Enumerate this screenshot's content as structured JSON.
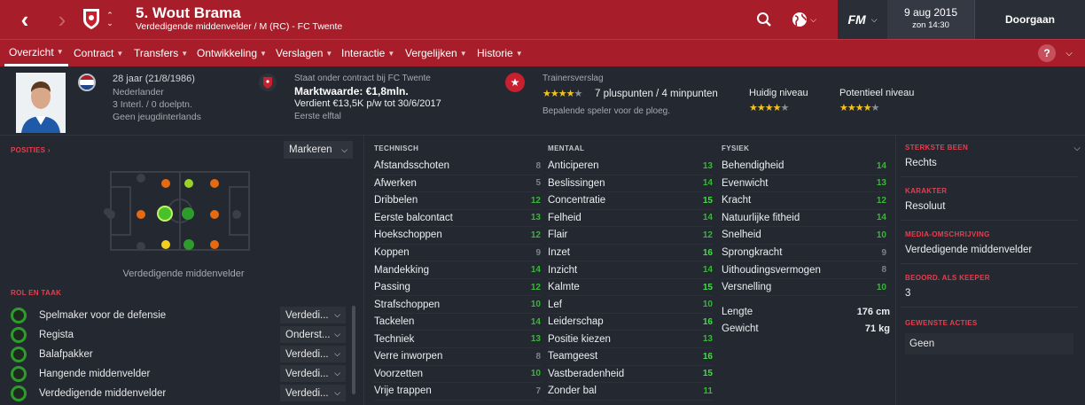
{
  "header": {
    "title": "5. Wout Brama",
    "subtitle": "Verdedigende middenvelder / M (RC) - FC Twente",
    "fm_logo": "FM",
    "date": "9 aug 2015",
    "time": "zon 14:30",
    "continue_label": "Doorgaan",
    "accent_color": "#a71d2a"
  },
  "menu": [
    {
      "label": "Overzicht"
    },
    {
      "label": "Contract"
    },
    {
      "label": "Transfers"
    },
    {
      "label": "Ontwikkeling"
    },
    {
      "label": "Verslagen"
    },
    {
      "label": "Interactie"
    },
    {
      "label": "Vergelijken"
    },
    {
      "label": "Historie"
    }
  ],
  "info": {
    "age": "28 jaar (21/8/1986)",
    "nationality": "Nederlander",
    "caps": "3 Interl. / 0 doelptn.",
    "youth": "Geen jeugdinterlands",
    "contract_label": "Staat onder contract bij FC Twente",
    "value": "Marktwaarde: €1,8mln.",
    "wage": "Verdient €13,5K p/w tot 30/6/2017",
    "squad": "Eerste elftal",
    "scout_label": "Trainersverslag",
    "points": "7 pluspunten / 4 minpunten",
    "scout_note": "Bepalende speler voor de ploeg.",
    "current_label": "Huidig niveau",
    "potential_label": "Potentieel niveau",
    "scout_stars": 4,
    "current_stars": 4,
    "potential_stars": 4
  },
  "positions": {
    "label": "POSITIES",
    "markeren": "Markeren",
    "caption": "Verdedigende middenvelder"
  },
  "roles": {
    "label": "ROL EN TAAK",
    "items": [
      {
        "name": "Spelmaker voor de defensie",
        "duty": "Verdedi..."
      },
      {
        "name": "Regista",
        "duty": "Onderst..."
      },
      {
        "name": "Balafpakker",
        "duty": "Verdedi..."
      },
      {
        "name": "Hangende middenvelder",
        "duty": "Verdedi..."
      },
      {
        "name": "Verdedigende middenvelder",
        "duty": "Verdedi..."
      }
    ]
  },
  "technical": {
    "label": "TECHNISCH",
    "items": [
      {
        "name": "Afstandsschoten",
        "value": "8"
      },
      {
        "name": "Afwerken",
        "value": "5"
      },
      {
        "name": "Dribbelen",
        "value": "12"
      },
      {
        "name": "Eerste balcontact",
        "value": "13"
      },
      {
        "name": "Hoekschoppen",
        "value": "12"
      },
      {
        "name": "Koppen",
        "value": "9"
      },
      {
        "name": "Mandekking",
        "value": "14"
      },
      {
        "name": "Passing",
        "value": "12"
      },
      {
        "name": "Strafschoppen",
        "value": "10"
      },
      {
        "name": "Tackelen",
        "value": "14"
      },
      {
        "name": "Techniek",
        "value": "13"
      },
      {
        "name": "Verre inworpen",
        "value": "8"
      },
      {
        "name": "Voorzetten",
        "value": "10"
      },
      {
        "name": "Vrije trappen",
        "value": "7"
      }
    ]
  },
  "mental": {
    "label": "MENTAAL",
    "items": [
      {
        "name": "Anticiperen",
        "value": "13"
      },
      {
        "name": "Beslissingen",
        "value": "14"
      },
      {
        "name": "Concentratie",
        "value": "15"
      },
      {
        "name": "Felheid",
        "value": "14"
      },
      {
        "name": "Flair",
        "value": "12"
      },
      {
        "name": "Inzet",
        "value": "16"
      },
      {
        "name": "Inzicht",
        "value": "14"
      },
      {
        "name": "Kalmte",
        "value": "15"
      },
      {
        "name": "Lef",
        "value": "10"
      },
      {
        "name": "Leiderschap",
        "value": "16"
      },
      {
        "name": "Positie kiezen",
        "value": "13"
      },
      {
        "name": "Teamgeest",
        "value": "16"
      },
      {
        "name": "Vastberadenheid",
        "value": "15"
      },
      {
        "name": "Zonder bal",
        "value": "11"
      }
    ]
  },
  "physical": {
    "label": "FYSIEK",
    "items": [
      {
        "name": "Behendigheid",
        "value": "14"
      },
      {
        "name": "Evenwicht",
        "value": "13"
      },
      {
        "name": "Kracht",
        "value": "12"
      },
      {
        "name": "Natuurlijke fitheid",
        "value": "14"
      },
      {
        "name": "Snelheid",
        "value": "10"
      },
      {
        "name": "Sprongkracht",
        "value": "9"
      },
      {
        "name": "Uithoudingsvermogen",
        "value": "8"
      },
      {
        "name": "Versnelling",
        "value": "10"
      }
    ],
    "height_label": "Lengte",
    "height": "176 cm",
    "weight_label": "Gewicht",
    "weight": "71 kg"
  },
  "side": {
    "foot_label": "STERKSTE BEEN",
    "foot": "Rechts",
    "character_label": "KARAKTER",
    "character": "Resoluut",
    "media_label": "MEDIA-OMSCHRIJVING",
    "media": "Verdedigende middenvelder",
    "gk_label": "BEOORD. ALS KEEPER",
    "gk": "3",
    "moves_label": "GEWENSTE ACTIES",
    "moves": "Geen"
  }
}
